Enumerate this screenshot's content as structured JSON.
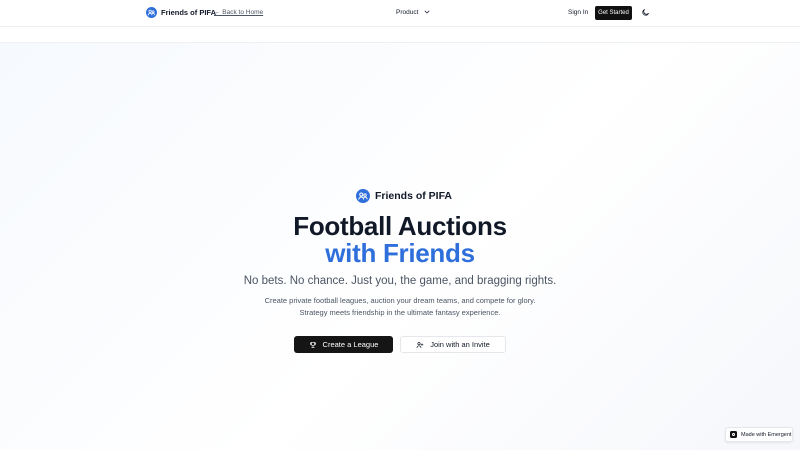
{
  "header": {
    "brand_name": "Friends of PIFA",
    "back_link": "← Back to Home",
    "product_menu": "Product",
    "sign_in": "Sign In",
    "get_started": "Get Started"
  },
  "hero": {
    "brand_name": "Friends of PIFA",
    "headline_line1": "Football Auctions",
    "headline_line2": "with Friends",
    "tagline": "No bets. No chance. Just you, the game, and bragging rights.",
    "description": "Create private football leagues, auction your dream teams, and compete for glory. Strategy meets friendship in the ultimate fantasy experience.",
    "create_button": "Create a League",
    "join_button": "Join with an Invite"
  },
  "badge": {
    "made_with": "Made with Emergent"
  },
  "colors": {
    "accent": "#2f6fdb",
    "primary_button": "#151515"
  },
  "icons": {
    "logo": "users-circle-icon",
    "product_chevron": "chevron-down-icon",
    "theme": "moon-icon",
    "create": "trophy-icon",
    "join": "user-plus-icon"
  }
}
